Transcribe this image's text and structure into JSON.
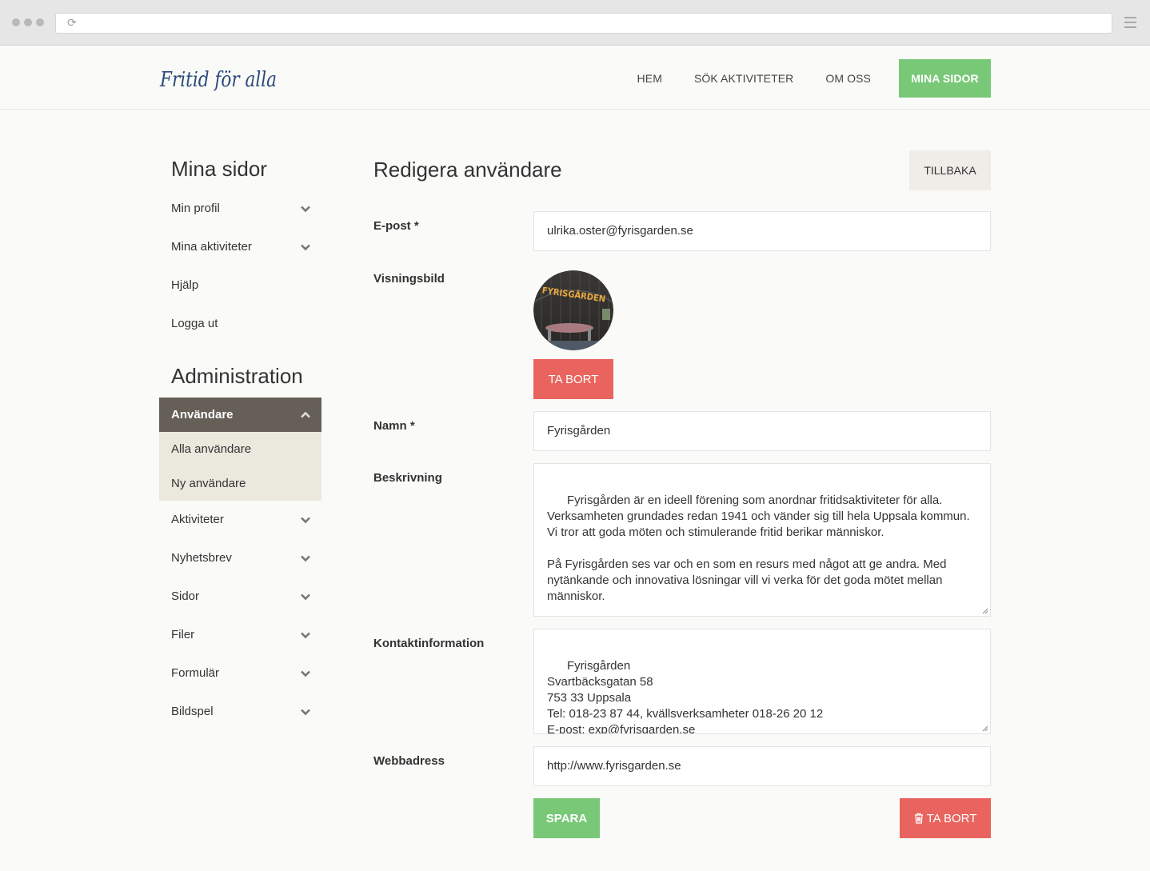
{
  "nav": {
    "items": [
      {
        "label": "HEM"
      },
      {
        "label": "SÖK AKTIVITETER"
      },
      {
        "label": "OM OSS"
      },
      {
        "label": "MINA SIDOR",
        "active": true
      }
    ]
  },
  "logo_text": "Fritid för alla",
  "sidebar": {
    "section1_title": "Mina sidor",
    "section1_items": [
      {
        "label": "Min profil",
        "icon": "chevron-down-icon"
      },
      {
        "label": "Mina aktiviteter",
        "icon": "chevron-down-icon"
      },
      {
        "label": "Hjälp"
      },
      {
        "label": "Logga ut"
      }
    ],
    "section2_title": "Administration",
    "open_item": {
      "label": "Användare",
      "icon": "chevron-up-icon"
    },
    "submenu": [
      {
        "label": "Alla användare"
      },
      {
        "label": "Ny användare"
      }
    ],
    "section2_items": [
      {
        "label": "Aktiviteter"
      },
      {
        "label": "Nyhetsbrev"
      },
      {
        "label": "Sidor"
      },
      {
        "label": "Filer"
      },
      {
        "label": "Formulär"
      },
      {
        "label": "Bildspel"
      }
    ]
  },
  "main": {
    "title": "Redigera användare",
    "back_label": "TILLBAKA",
    "fields": {
      "email_label": "E-post *",
      "email_value": "ulrika.oster@fyrisgarden.se",
      "avatar_label": "Visningsbild",
      "avatar_text": "FYRISGÅRDEN",
      "remove_image_label": "TA BORT",
      "name_label": "Namn *",
      "name_value": "Fyrisgården",
      "description_label": "Beskrivning",
      "description_value": "Fyrisgården är en ideell förening som anordnar fritidsaktiviteter för alla. Verksamheten grundades redan 1941 och vänder sig till hela Uppsala kommun. Vi tror att goda möten och stimulerande fritid berikar människor.\n\nPå Fyrisgården ses var och en som en resurs med något att ge andra. Med nytänkande och innovativa lösningar vill vi verka för det goda mötet mellan människor.",
      "contact_label": "Kontaktinformation",
      "contact_value": "Fyrisgården\nSvartbäcksgatan 58\n753 33 Uppsala\nTel: 018-23 87 44, kvällsverksamheter 018-26 20 12\nE-post: exp@fyrisgarden.se",
      "web_label": "Webbadress",
      "web_value": "http://www.fyrisgarden.se"
    },
    "save_label": "SPARA",
    "delete_label": "TA BORT"
  },
  "colors": {
    "accent_green": "#78c878",
    "danger_red": "#e9645e",
    "sidebar_active": "#665f57",
    "submenu_bg": "#ebe8de",
    "logo_blue": "#2b4a78"
  }
}
